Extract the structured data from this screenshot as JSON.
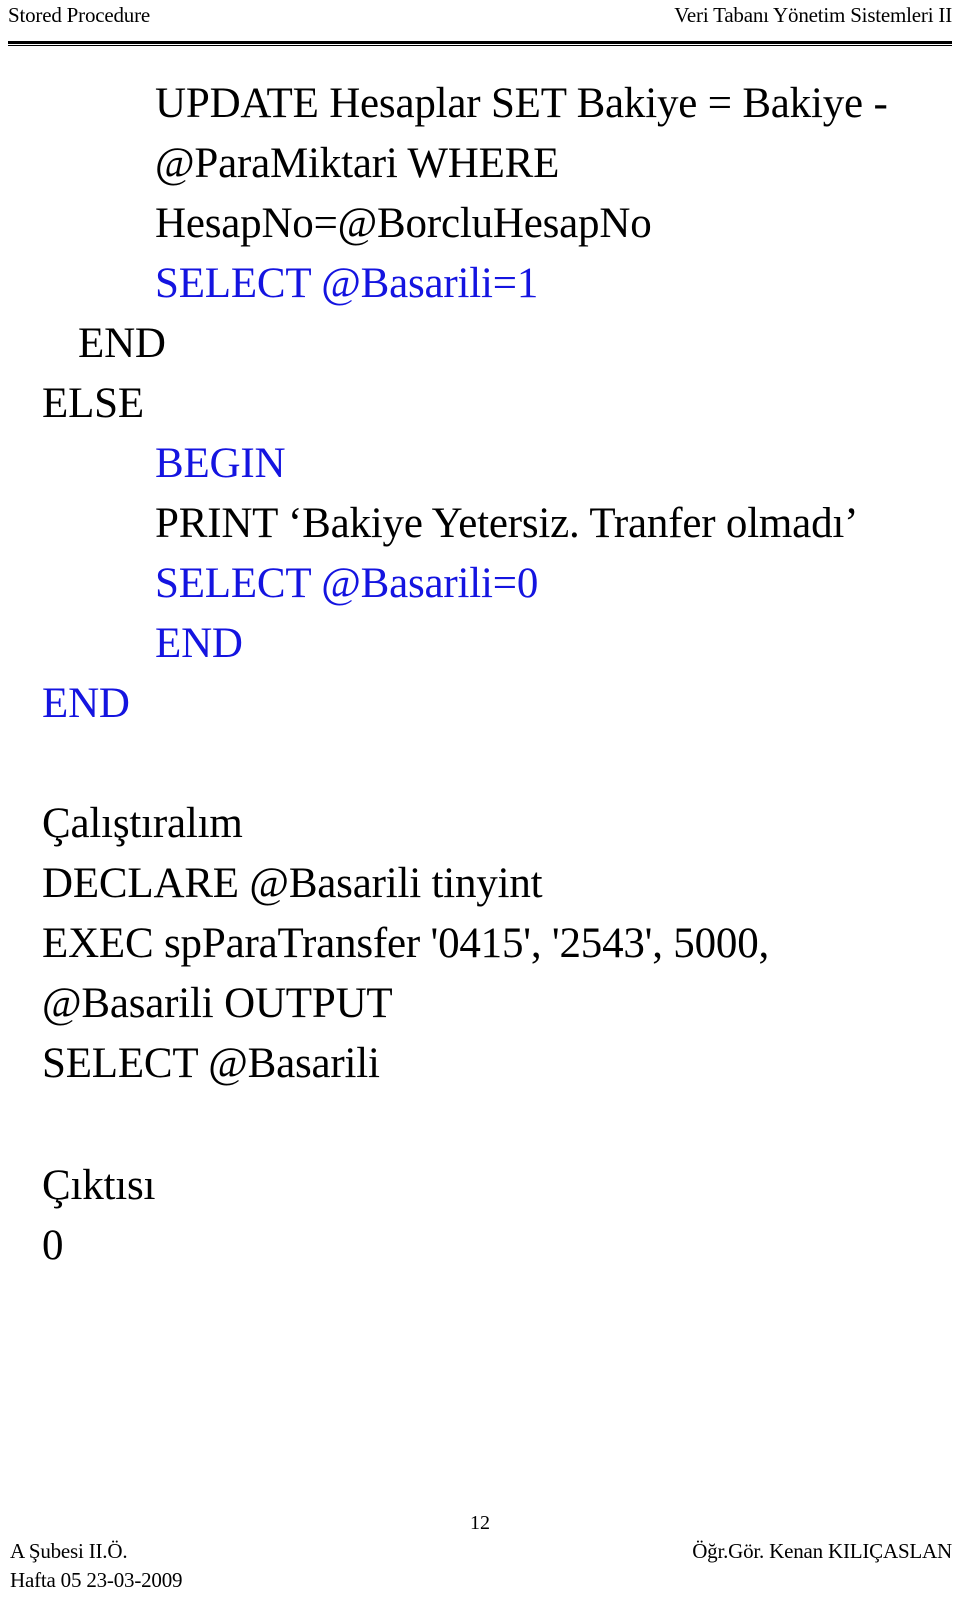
{
  "header": {
    "left_title": "Stored Procedure",
    "right_title": "Veri Tabanı Yönetim Sistemleri II"
  },
  "body": {
    "lines": [
      {
        "text": "UPDATE Hesaplar SET Bakiye = Bakiye - @ParaMiktari WHERE HesapNo=@BorcluHesapNo",
        "color": "black",
        "indent": 3
      },
      {
        "text": "SELECT @Basarili=1",
        "color": "blue",
        "indent": 2
      },
      {
        "text": "END",
        "color": "black",
        "indent": 1
      },
      {
        "text": "ELSE",
        "color": "black",
        "indent": 0
      },
      {
        "text": "BEGIN",
        "color": "blue",
        "indent": 2
      },
      {
        "text": "PRINT ‘Bakiye Yetersiz. Tranfer olmadı’",
        "color": "black",
        "indent": 2
      },
      {
        "text": "SELECT @Basarili=0",
        "color": "blue",
        "indent": 2
      },
      {
        "text": "END",
        "color": "blue",
        "indent": 2
      },
      {
        "text": "END",
        "color": "blue",
        "indent": 0
      },
      {
        "text": "Çalıştıralım",
        "color": "black",
        "indent": 0
      },
      {
        "text": "DECLARE @Basarili tinyint",
        "color": "black",
        "indent": 0
      },
      {
        "text": "EXEC spParaTransfer '0415', '2543', 5000, @Basarili OUTPUT",
        "color": "black",
        "indent": 0
      },
      {
        "text": "SELECT @Basarili",
        "color": "black",
        "indent": 0
      },
      {
        "text": "Çıktısı",
        "color": "black",
        "indent": 0
      },
      {
        "text": "0",
        "color": "black",
        "indent": 0
      }
    ],
    "line_1": "UPDATE Hesaplar SET Bakiye = Bakiye - @ParaMiktari WHERE HesapNo=@BorcluHesapNo",
    "line_2": "SELECT @Basarili=1",
    "line_3": "END",
    "line_4": "ELSE",
    "line_5": "BEGIN",
    "line_6": "PRINT ‘Bakiye Yetersiz. Tranfer olmadı’",
    "line_7": "SELECT @Basarili=0",
    "line_8": "END",
    "line_9": "END",
    "line_10": "Çalıştıralım",
    "line_11": "DECLARE @Basarili tinyint",
    "line_12": "EXEC spParaTransfer '0415', '2543', 5000, @Basarili OUTPUT",
    "line_13": "SELECT @Basarili",
    "line_14": "Çıktısı",
    "line_15": "0"
  },
  "footer": {
    "page_number": "12",
    "left_line_1": "A Şubesi II.Ö.",
    "left_line_2": "Hafta 05  23-03-2009",
    "right": "Öğr.Gör. Kenan KILIÇASLAN"
  },
  "colors": {
    "text": "#000000",
    "keyword_blue": "#1414e0",
    "background": "#ffffff",
    "rule": "#000000"
  }
}
